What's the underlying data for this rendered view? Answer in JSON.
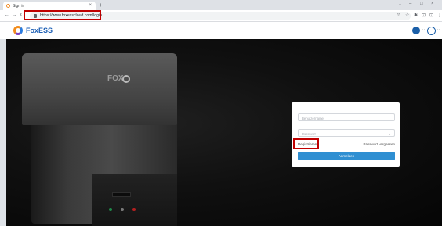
{
  "browser": {
    "tab_title": "Sign in",
    "new_tab_symbol": "+",
    "url": "https://www.foxesscloud.com/login",
    "nav": {
      "back": "←",
      "forward": "→",
      "reload": "C"
    },
    "window_controls": [
      "⌄",
      "–",
      "□",
      "×"
    ],
    "toolbar_icons": [
      "⇪",
      "☆",
      "✱",
      "⊡",
      "⊡",
      "⋮"
    ]
  },
  "app": {
    "brand": "FoxESS",
    "more_symbol": "···",
    "caret": "⌄"
  },
  "hero": {
    "inverter_logo": "FOX"
  },
  "login": {
    "username_placeholder": "Benutzername",
    "password_placeholder": "Passwort",
    "select_caret": "⌄",
    "register_label": "Registrieren",
    "forgot_label": "Passwort vergessen",
    "submit_label": "Anmelden"
  },
  "colors": {
    "highlight": "#c00000",
    "brand_blue": "#1d5fb4",
    "button_blue": "#2f8fd2",
    "logo_orange": "#f28c1c"
  }
}
